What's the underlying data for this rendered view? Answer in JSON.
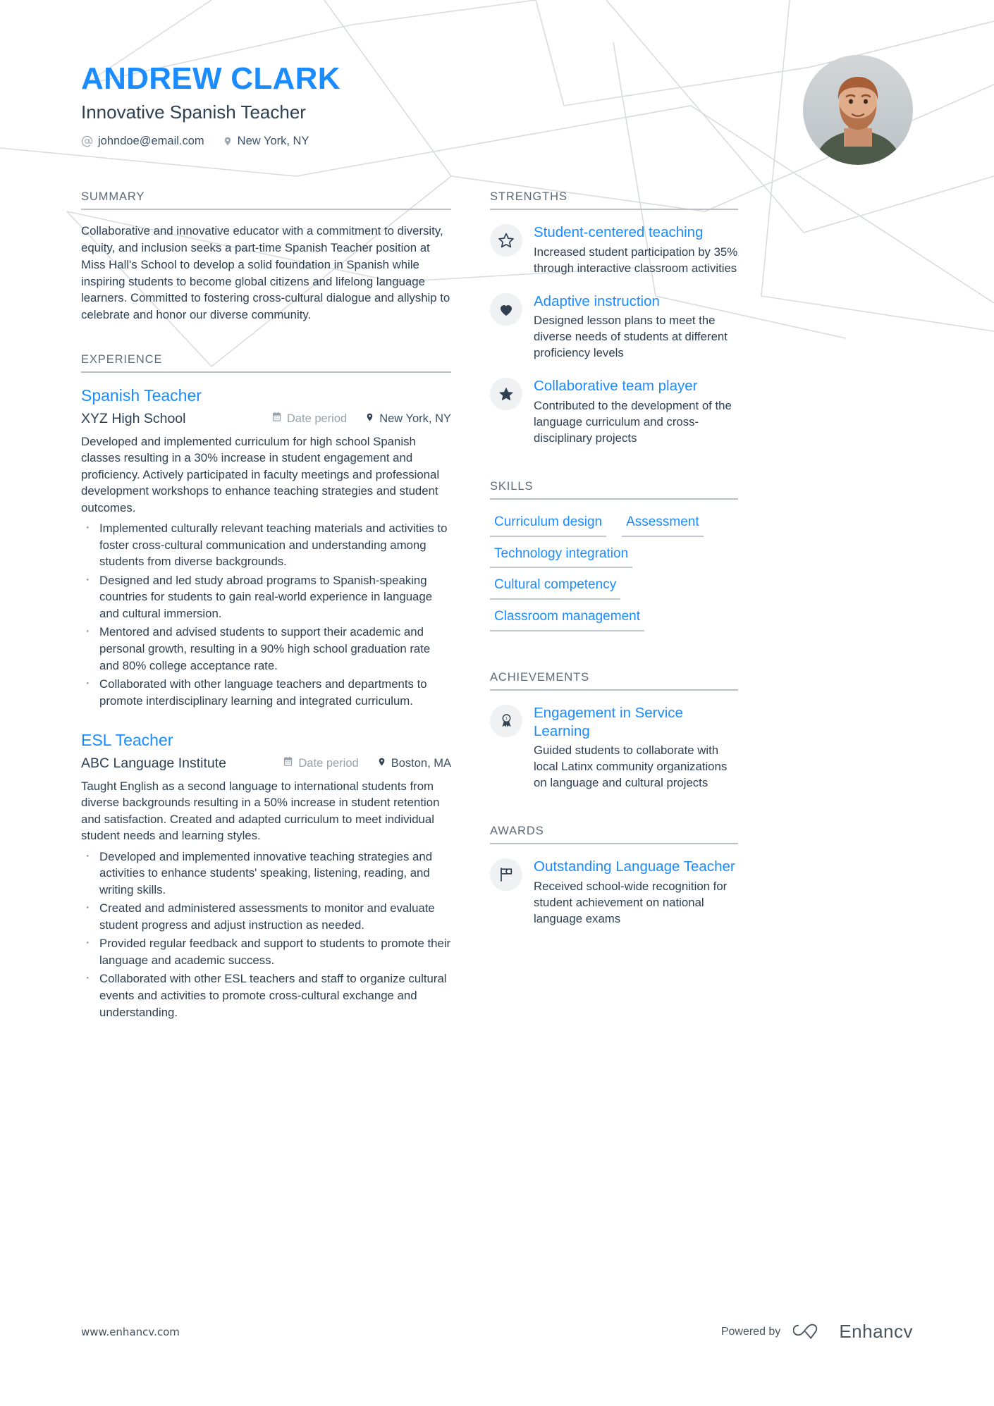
{
  "header": {
    "name": "ANDREW CLARK",
    "job_title": "Innovative Spanish Teacher",
    "email": "johndoe@email.com",
    "location": "New York, NY",
    "email_icon": "at-icon",
    "location_icon": "map-pin-icon",
    "avatar_alt": "profile-photo"
  },
  "colors": {
    "accent": "#1a8cff",
    "text": "#2e4052",
    "muted": "#98a2ab",
    "rule": "#b9bfc4",
    "icon_bg": "#f0f1f3"
  },
  "summary": {
    "title": "SUMMARY",
    "text": "Collaborative and innovative educator with a commitment to diversity, equity, and inclusion seeks a part-time Spanish Teacher position at Miss Hall's School to develop a solid foundation in Spanish while inspiring students to become global citizens and lifelong language learners. Committed to fostering cross-cultural dialogue and allyship to celebrate and honor our diverse community."
  },
  "experience": {
    "title": "EXPERIENCE",
    "items": [
      {
        "role": "Spanish Teacher",
        "company": "XYZ High School",
        "date": "Date period",
        "location": "New York, NY",
        "description": "Developed and implemented curriculum for high school Spanish classes resulting in a 30% increase in student engagement and proficiency. Actively participated in faculty meetings and professional development workshops to enhance teaching strategies and student outcomes.",
        "bullets": [
          "Implemented culturally relevant teaching materials and activities to foster cross-cultural communication and understanding among students from diverse backgrounds.",
          "Designed and led study abroad programs to Spanish-speaking countries for students to gain real-world experience in language and cultural immersion.",
          "Mentored and advised students to support their academic and personal growth, resulting in a 90% high school graduation rate and 80% college acceptance rate.",
          "Collaborated with other language teachers and departments to promote interdisciplinary learning and integrated curriculum."
        ]
      },
      {
        "role": "ESL Teacher",
        "company": "ABC Language Institute",
        "date": "Date period",
        "location": "Boston, MA",
        "description": "Taught English as a second language to international students from diverse backgrounds resulting in a 50% increase in student retention and satisfaction. Created and adapted curriculum to meet individual student needs and learning styles.",
        "bullets": [
          "Developed and implemented innovative teaching strategies and activities to enhance students' speaking, listening, reading, and writing skills.",
          "Created and administered assessments to monitor and evaluate student progress and adjust instruction as needed.",
          "Provided regular feedback and support to students to promote their language and academic success.",
          "Collaborated with other ESL teachers and staff to organize cultural events and activities to promote cross-cultural exchange and understanding."
        ]
      }
    ]
  },
  "strengths": {
    "title": "STRENGTHS",
    "items": [
      {
        "icon": "star-outline-icon",
        "title": "Student-centered teaching",
        "desc": "Increased student participation by 35% through interactive classroom activities"
      },
      {
        "icon": "heart-filled-icon",
        "title": "Adaptive instruction",
        "desc": "Designed lesson plans to meet the diverse needs of students at different proficiency levels"
      },
      {
        "icon": "star-filled-icon",
        "title": "Collaborative team player",
        "desc": "Contributed to the development of the language curriculum and cross-disciplinary projects"
      }
    ]
  },
  "skills": {
    "title": "SKILLS",
    "items": [
      "Curriculum design",
      "Assessment",
      "Technology integration",
      "Cultural competency",
      "Classroom management"
    ]
  },
  "achievements": {
    "title": "ACHIEVEMENTS",
    "items": [
      {
        "icon": "medal-ribbon-icon",
        "title": "Engagement in Service Learning",
        "desc": "Guided students to collaborate with local Latinx community organizations on language and cultural projects"
      }
    ]
  },
  "awards": {
    "title": "AWARDS",
    "items": [
      {
        "icon": "flag-outline-icon",
        "title": "Outstanding Language Teacher",
        "desc": "Received school-wide recognition for student achievement on national language exams"
      }
    ]
  },
  "footer": {
    "url": "www.enhancv.com",
    "powered_by": "Powered by",
    "brand": "Enhancv",
    "brand_icon": "enhancv-logo-icon"
  }
}
